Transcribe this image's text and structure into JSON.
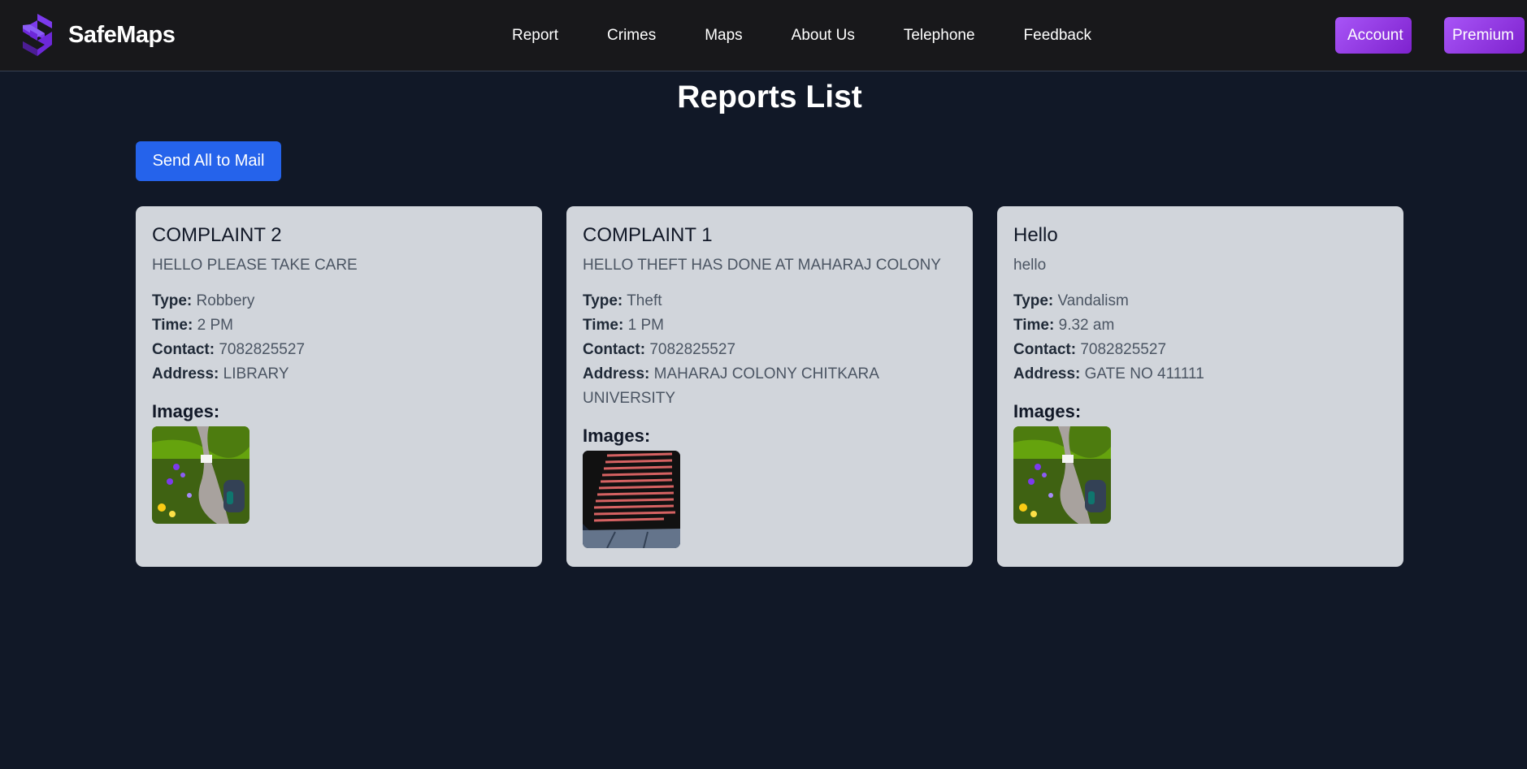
{
  "brand": {
    "name": "SafeMaps",
    "logo_icon": "safemaps-logo-icon"
  },
  "nav": {
    "links": [
      "Report",
      "Crimes",
      "Maps",
      "About Us",
      "Telephone",
      "Feedback"
    ],
    "account_label": "Account",
    "premium_label": "Premium"
  },
  "main": {
    "title": "Reports List",
    "send_all_label": "Send All to Mail",
    "field_labels": {
      "type": "Type:",
      "time": "Time:",
      "contact": "Contact:",
      "address": "Address:",
      "images": "Images:"
    },
    "reports": [
      {
        "title": "COMPLAINT 2",
        "description": "HELLO PLEASE TAKE CARE",
        "type": "Robbery",
        "time": "2 PM",
        "contact": "7082825527",
        "address": "LIBRARY",
        "image": "meadow-backpack-photo"
      },
      {
        "title": "COMPLAINT 1",
        "description": "HELLO THEFT HAS DONE AT MAHARAJ COLONY",
        "type": "Theft",
        "time": "1 PM",
        "contact": "7082825527",
        "address": "MAHARAJ COLONY CHITKARA UNIVERSITY",
        "image": "departure-board-photo"
      },
      {
        "title": "Hello",
        "description": "hello",
        "type": "Vandalism",
        "time": "9.32 am",
        "contact": "7082825527",
        "address": "GATE NO 411111",
        "image": "meadow-backpack-photo"
      }
    ]
  },
  "colors": {
    "background": "#111827",
    "navbar": "#18181b",
    "accent_purple": "#a855f7",
    "primary_blue": "#2563eb",
    "card": "#d1d5db"
  }
}
